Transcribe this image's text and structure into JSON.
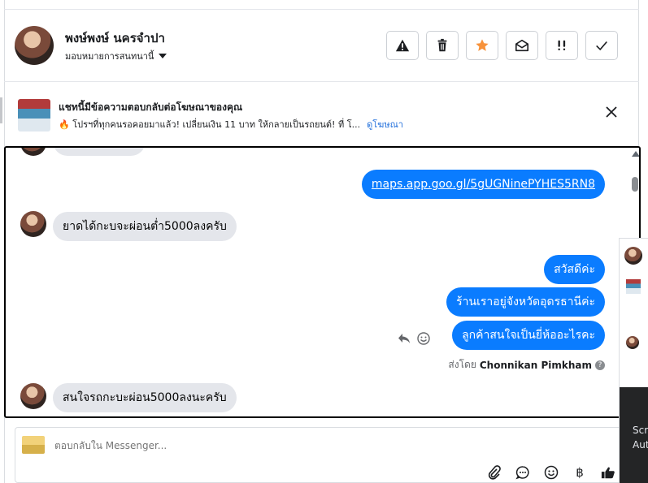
{
  "header": {
    "contact_name": "พงษ์พงษ์ นครจำปา",
    "assign_label": "มอบหมายการสนทนานี้",
    "actions": [
      "warning-icon",
      "trash-icon",
      "star-icon",
      "mark-unread-icon",
      "priority-icon",
      "done-icon"
    ],
    "star_color": "#f7923b"
  },
  "ad_banner": {
    "title": "แชทนี้มีข้อความตอบกลับต่อโฆษณาของคุณ",
    "subtitle": "🔥 โปรฯที่ทุกคนรอคอยมาแล้ว! เปลี่ยนเงิน 11 บาท ให้กลายเป็นรถยนต์! ที่ โ...",
    "link": "ดูโฆษณา"
  },
  "messages": [
    {
      "direction": "out",
      "text": "maps.app.goo.gl/5gUGNinePYHES5RN8",
      "is_link": true
    },
    {
      "direction": "in",
      "text": "ยาดได้กะบจะผ่อนต่ำ5000ลงครับ"
    },
    {
      "direction": "out",
      "text": "สวัสดีค่ะ"
    },
    {
      "direction": "out",
      "text": "ร้านเราอยู่จังหวัดอุดรธานีค่ะ"
    },
    {
      "direction": "out",
      "text": "ลูกค้าสนใจเป็นยี่ห้ออะไรคะ"
    },
    {
      "direction": "in",
      "text": "สนใจรถกะบะผ่อน5000ลงนะครับ"
    }
  ],
  "sent_by": {
    "prefix": "ส่งโดย",
    "name": "Chonnikan Pimkham"
  },
  "composer": {
    "placeholder": "ตอบกลับใน Messenger..."
  },
  "overlay": {
    "text_1": "Scr",
    "text_2": "Aut"
  },
  "colors": {
    "outgoing_bubble": "#0a7cff",
    "incoming_bubble": "#e4e6eb",
    "link": "#216fdb"
  }
}
